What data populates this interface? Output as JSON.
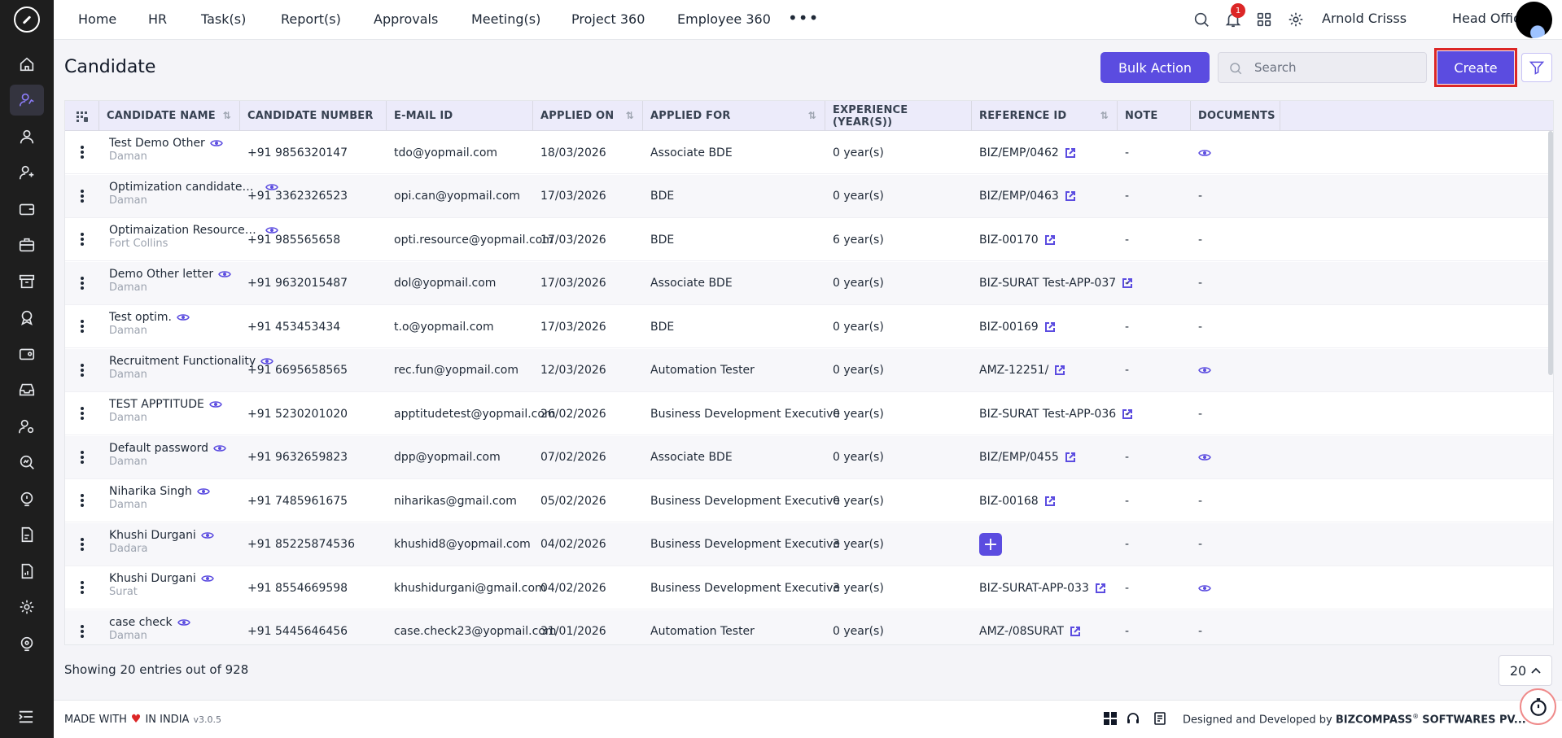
{
  "nav": {
    "items": [
      "Home",
      "HR",
      "Task(s)",
      "Report(s)",
      "Approvals",
      "Meeting(s)",
      "Project 360",
      "Employee 360"
    ],
    "more": "•••",
    "notification_count": "1",
    "user_name": "Arnold Crisss",
    "office": "Head Office"
  },
  "page": {
    "title": "Candidate",
    "bulk_action_label": "Bulk Action",
    "search_placeholder": "Search",
    "create_label": "Create"
  },
  "table": {
    "columns": [
      {
        "label": "CANDIDATE NAME",
        "sortable": true
      },
      {
        "label": "CANDIDATE NUMBER",
        "sortable": false
      },
      {
        "label": "E-MAIL ID",
        "sortable": false
      },
      {
        "label": "APPLIED ON",
        "sortable": true
      },
      {
        "label": "APPLIED FOR",
        "sortable": true
      },
      {
        "label": "EXPERIENCE (YEAR(S))",
        "sortable": false
      },
      {
        "label": "REFERENCE ID",
        "sortable": true
      },
      {
        "label": "NOTE",
        "sortable": false
      },
      {
        "label": "DOCUMENTS",
        "sortable": false
      }
    ],
    "rows": [
      {
        "name": "Test Demo Other",
        "location": "Daman",
        "number": "+91 9856320147",
        "email": "tdo@yopmail.com",
        "applied_on": "18/03/2026",
        "applied_for": "Associate BDE",
        "experience": "0 year(s)",
        "reference": "BIZ/EMP/0462",
        "note": "-",
        "documents": "view"
      },
      {
        "name": "Optimization candidatem...",
        "location": "Daman",
        "number": "+91 3362326523",
        "email": "opi.can@yopmail.com",
        "applied_on": "17/03/2026",
        "applied_for": "BDE",
        "experience": "0 year(s)",
        "reference": "BIZ/EMP/0463",
        "note": "-",
        "documents": "-"
      },
      {
        "name": "Optimaization ResourceR...",
        "location": "Fort Collins",
        "number": "+91 985565658",
        "email": "opti.resource@yopmail.com",
        "applied_on": "17/03/2026",
        "applied_for": "BDE",
        "experience": "6 year(s)",
        "reference": "BIZ-00170",
        "note": "-",
        "documents": "-"
      },
      {
        "name": "Demo Other letter",
        "location": "Daman",
        "number": "+91 9632015487",
        "email": "dol@yopmail.com",
        "applied_on": "17/03/2026",
        "applied_for": "Associate BDE",
        "experience": "0 year(s)",
        "reference": "BIZ-SURAT Test-APP-037",
        "note": "-",
        "documents": "-"
      },
      {
        "name": "Test optim.",
        "location": "Daman",
        "number": "+91 453453434",
        "email": "t.o@yopmail.com",
        "applied_on": "17/03/2026",
        "applied_for": "BDE",
        "experience": "0 year(s)",
        "reference": "BIZ-00169",
        "note": "-",
        "documents": "-"
      },
      {
        "name": "Recruitment Functionality",
        "location": "Daman",
        "number": "+91 6695658565",
        "email": "rec.fun@yopmail.com",
        "applied_on": "12/03/2026",
        "applied_for": "Automation Tester",
        "experience": "0 year(s)",
        "reference": "AMZ-12251/",
        "note": "-",
        "documents": "view"
      },
      {
        "name": "TEST APPTITUDE",
        "location": "Daman",
        "number": "+91 5230201020",
        "email": "apptitudetest@yopmail.com",
        "applied_on": "26/02/2026",
        "applied_for": "Business Development Executive",
        "experience": "0 year(s)",
        "reference": "BIZ-SURAT Test-APP-036",
        "note": "-",
        "documents": "-"
      },
      {
        "name": "Default password",
        "location": "Daman",
        "number": "+91 9632659823",
        "email": "dpp@yopmail.com",
        "applied_on": "07/02/2026",
        "applied_for": "Associate BDE",
        "experience": "0 year(s)",
        "reference": "BIZ/EMP/0455",
        "note": "-",
        "documents": "view"
      },
      {
        "name": "Niharika Singh",
        "location": "Daman",
        "number": "+91 7485961675",
        "email": "niharikas@gmail.com",
        "applied_on": "05/02/2026",
        "applied_for": "Business Development Executive",
        "experience": "0 year(s)",
        "reference": "BIZ-00168",
        "note": "-",
        "documents": "-"
      },
      {
        "name": "Khushi Durgani",
        "location": "Dadara",
        "number": "+91 85225874536",
        "email": "khushid8@yopmail.com",
        "applied_on": "04/02/2026",
        "applied_for": "Business Development Executive",
        "experience": "3 year(s)",
        "reference": "",
        "note": "-",
        "documents": "-"
      },
      {
        "name": "Khushi Durgani",
        "location": "Surat",
        "number": "+91 8554669598",
        "email": "khushidurgani@gmail.com",
        "applied_on": "04/02/2026",
        "applied_for": "Business Development Executive",
        "experience": "3 year(s)",
        "reference": "BIZ-SURAT-APP-033",
        "note": "-",
        "documents": "view"
      },
      {
        "name": "case check",
        "location": "Daman",
        "number": "+91 5445646456",
        "email": "case.check23@yopmail.com",
        "applied_on": "31/01/2026",
        "applied_for": "Automation Tester",
        "experience": "0 year(s)",
        "reference": "AMZ-/08SURAT",
        "note": "-",
        "documents": "-"
      }
    ]
  },
  "pagination": {
    "showing_text": "Showing 20 entries out of 928",
    "page_size": "20"
  },
  "footer": {
    "made_with": "MADE WITH",
    "in_india": "IN INDIA",
    "version": "v3.0.5",
    "designed_by": "Designed and Developed by",
    "company": "BIZCOMPASS",
    "company_suffix": "SOFTWARES PV..."
  },
  "colors": {
    "accent": "#5b4ce0",
    "sidebar": "#1e1e1e",
    "header_bg": "#ecebfa",
    "highlight_border": "#dc2626"
  }
}
